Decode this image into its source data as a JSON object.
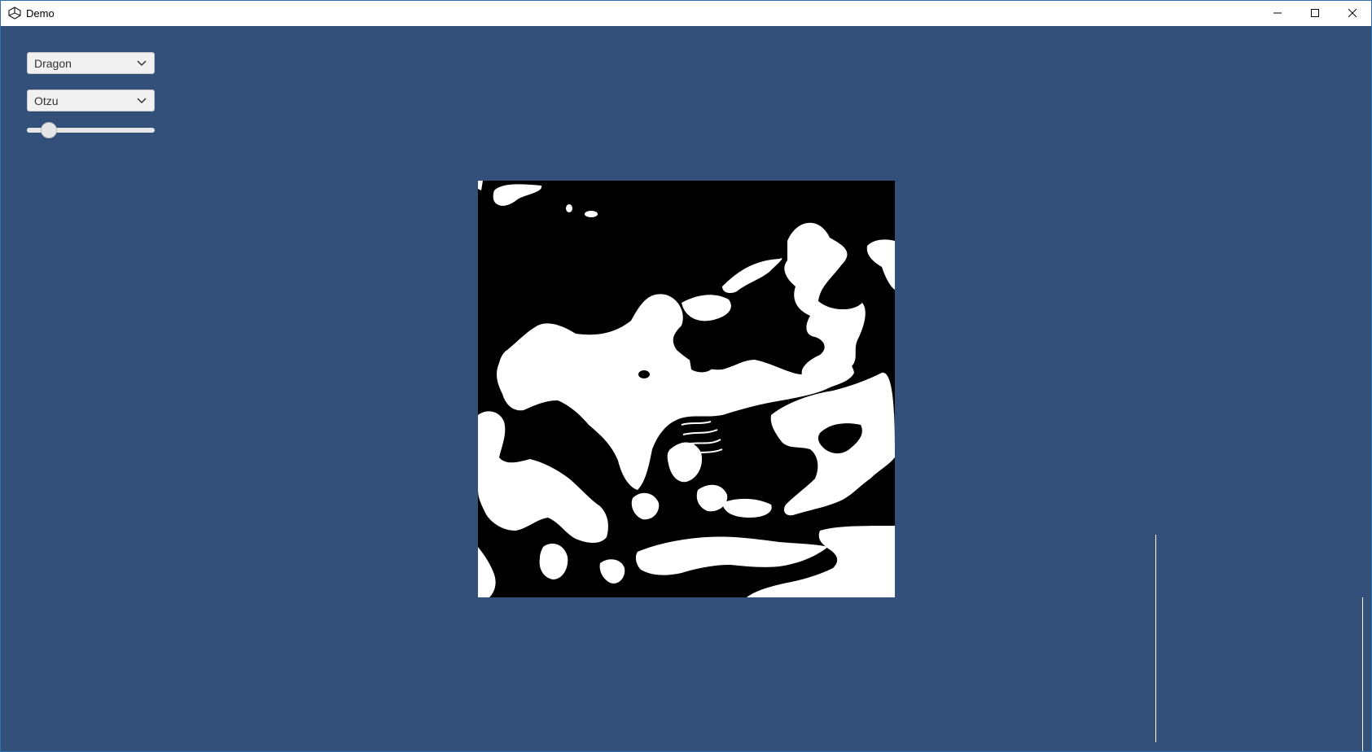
{
  "window": {
    "title": "Demo",
    "app_icon": "unity-logo-icon",
    "controls": [
      "minimize-icon",
      "maximize-icon",
      "close-icon"
    ]
  },
  "colors": {
    "background": "#33507a",
    "image_foreground": "#ffffff",
    "image_background": "#000000"
  },
  "controls": {
    "image_select": {
      "selected": "Dragon"
    },
    "method_select": {
      "selected": "Otzu"
    },
    "threshold_slider": {
      "value_fraction": 0.17
    }
  },
  "main": {
    "image_description": "binarized dragon image (black and white)"
  }
}
